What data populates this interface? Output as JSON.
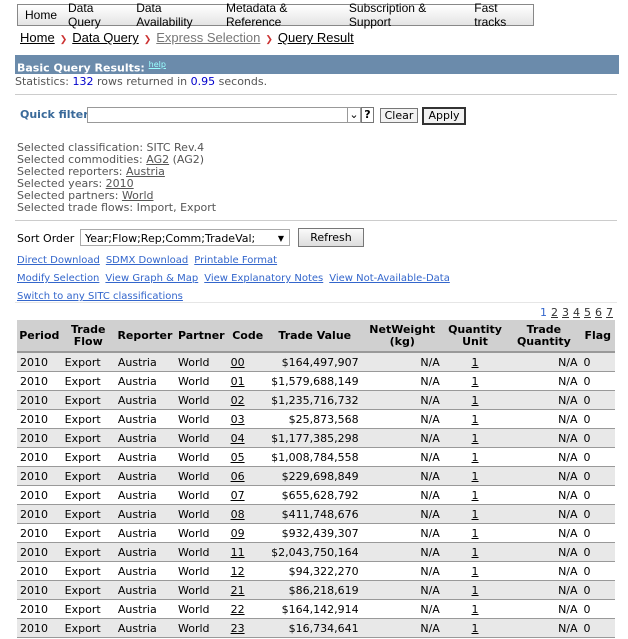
{
  "nav": [
    "Home",
    "Data Query",
    "Data Availability",
    "Metadata & Reference",
    "Subscription & Support",
    "Fast tracks"
  ],
  "breadcrumb": [
    "Home",
    "Data Query",
    "Express Selection",
    "Query Result"
  ],
  "results_bar": {
    "title": "Basic Query Results:",
    "help": "help"
  },
  "stats": {
    "prefix": "Statistics:",
    "rows": "132",
    "mid": "rows returned in",
    "seconds": "0.95",
    "suffix": "seconds."
  },
  "quick_filter": {
    "label": "Quick filter",
    "value": "",
    "help": "?",
    "clear": "Clear",
    "apply": "Apply"
  },
  "selection": {
    "classification_label": "Selected classification:",
    "classification": "SITC Rev.4",
    "commodities_label": "Selected commodities:",
    "commodities": "AG2",
    "commodities_suffix": "(AG2)",
    "reporters_label": "Selected reporters:",
    "reporters": "Austria",
    "years_label": "Selected years:",
    "years": "2010",
    "partners_label": "Selected partners:",
    "partners": "World",
    "flows_label": "Selected trade flows:",
    "flows": "Import, Export"
  },
  "sort": {
    "label": "Sort Order",
    "value": "Year;Flow;Rep;Comm;TradeVal;",
    "refresh": "Refresh"
  },
  "links1": [
    "Direct Download",
    "SDMX Download",
    "Printable Format"
  ],
  "links2": [
    "Modify Selection",
    "View Graph & Map",
    "View Explanatory Notes",
    "View Not-Available-Data"
  ],
  "links3": [
    "Switch to any SITC classifications"
  ],
  "pages": [
    "1",
    "2",
    "3",
    "4",
    "5",
    "6",
    "7"
  ],
  "table": {
    "headers": [
      "Period",
      "Trade Flow",
      "Reporter",
      "Partner",
      "Code",
      "Trade Value",
      "NetWeight (kg)",
      "Quantity Unit",
      "Trade Quantity",
      "Flag"
    ],
    "rows": [
      [
        "2010",
        "Export",
        "Austria",
        "World",
        "00",
        "$164,497,907",
        "N/A",
        "1",
        "N/A",
        "0"
      ],
      [
        "2010",
        "Export",
        "Austria",
        "World",
        "01",
        "$1,579,688,149",
        "N/A",
        "1",
        "N/A",
        "0"
      ],
      [
        "2010",
        "Export",
        "Austria",
        "World",
        "02",
        "$1,235,716,732",
        "N/A",
        "1",
        "N/A",
        "0"
      ],
      [
        "2010",
        "Export",
        "Austria",
        "World",
        "03",
        "$25,873,568",
        "N/A",
        "1",
        "N/A",
        "0"
      ],
      [
        "2010",
        "Export",
        "Austria",
        "World",
        "04",
        "$1,177,385,298",
        "N/A",
        "1",
        "N/A",
        "0"
      ],
      [
        "2010",
        "Export",
        "Austria",
        "World",
        "05",
        "$1,008,784,558",
        "N/A",
        "1",
        "N/A",
        "0"
      ],
      [
        "2010",
        "Export",
        "Austria",
        "World",
        "06",
        "$229,698,849",
        "N/A",
        "1",
        "N/A",
        "0"
      ],
      [
        "2010",
        "Export",
        "Austria",
        "World",
        "07",
        "$655,628,792",
        "N/A",
        "1",
        "N/A",
        "0"
      ],
      [
        "2010",
        "Export",
        "Austria",
        "World",
        "08",
        "$411,748,676",
        "N/A",
        "1",
        "N/A",
        "0"
      ],
      [
        "2010",
        "Export",
        "Austria",
        "World",
        "09",
        "$932,439,307",
        "N/A",
        "1",
        "N/A",
        "0"
      ],
      [
        "2010",
        "Export",
        "Austria",
        "World",
        "11",
        "$2,043,750,164",
        "N/A",
        "1",
        "N/A",
        "0"
      ],
      [
        "2010",
        "Export",
        "Austria",
        "World",
        "12",
        "$94,322,270",
        "N/A",
        "1",
        "N/A",
        "0"
      ],
      [
        "2010",
        "Export",
        "Austria",
        "World",
        "21",
        "$86,218,619",
        "N/A",
        "1",
        "N/A",
        "0"
      ],
      [
        "2010",
        "Export",
        "Austria",
        "World",
        "22",
        "$164,142,914",
        "N/A",
        "1",
        "N/A",
        "0"
      ],
      [
        "2010",
        "Export",
        "Austria",
        "World",
        "23",
        "$16,734,641",
        "N/A",
        "1",
        "N/A",
        "0"
      ]
    ]
  }
}
